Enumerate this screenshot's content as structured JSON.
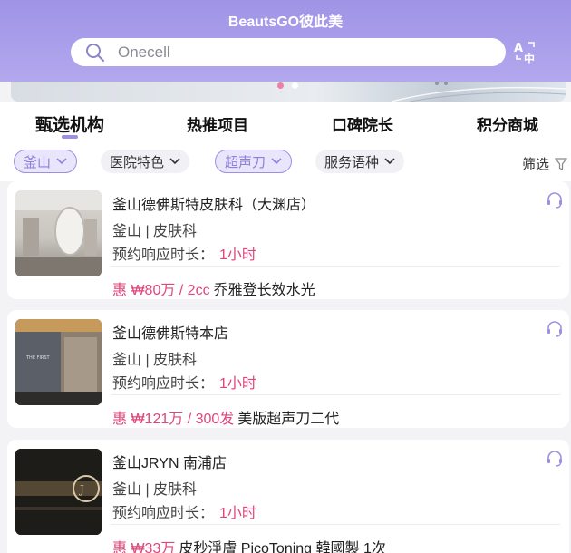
{
  "header": {
    "title": "BeautsGO彼此美"
  },
  "search": {
    "value": "Onecell"
  },
  "tabs": [
    {
      "label": "甄选机构"
    },
    {
      "label": "热推项目"
    },
    {
      "label": "口碑院长"
    },
    {
      "label": "积分商城"
    }
  ],
  "filters": [
    {
      "label": "釜山"
    },
    {
      "label": "医院特色"
    },
    {
      "label": "超声刀"
    },
    {
      "label": "服务语种"
    }
  ],
  "filter_button": {
    "label": "筛选"
  },
  "clinics": [
    {
      "name": "釜山德佛斯特皮肤科（大渊店）",
      "category": "釜山 | 皮肤科",
      "response_label": "预约响应时长：",
      "response_value": "1小时",
      "price": "惠 ₩80万 / 2cc",
      "item": "乔雅登长效水光"
    },
    {
      "name": "釜山德佛斯特本店",
      "category": "釜山 | 皮肤科",
      "response_label": "预约响应时长：",
      "response_value": "1小时",
      "price": "惠 ₩121万 / 300发",
      "item": "美版超声刀二代"
    },
    {
      "name": "釜山JRYN 南浦店",
      "category": "釜山 | 皮肤科",
      "response_label": "预约响应时长：",
      "response_value": "1小时",
      "price": "惠 ₩33万",
      "item": "皮秒淨膚 PicoToning 韓國製 1次"
    }
  ],
  "colors": {
    "accent": "#9d8fe6",
    "price": "#e0457b",
    "header": "#a89ceb"
  },
  "icons": {
    "search": "search-icon",
    "translate": "translate-icon",
    "chevron": "chevron-down-icon",
    "filter": "filter-icon",
    "headset": "headset-icon"
  }
}
